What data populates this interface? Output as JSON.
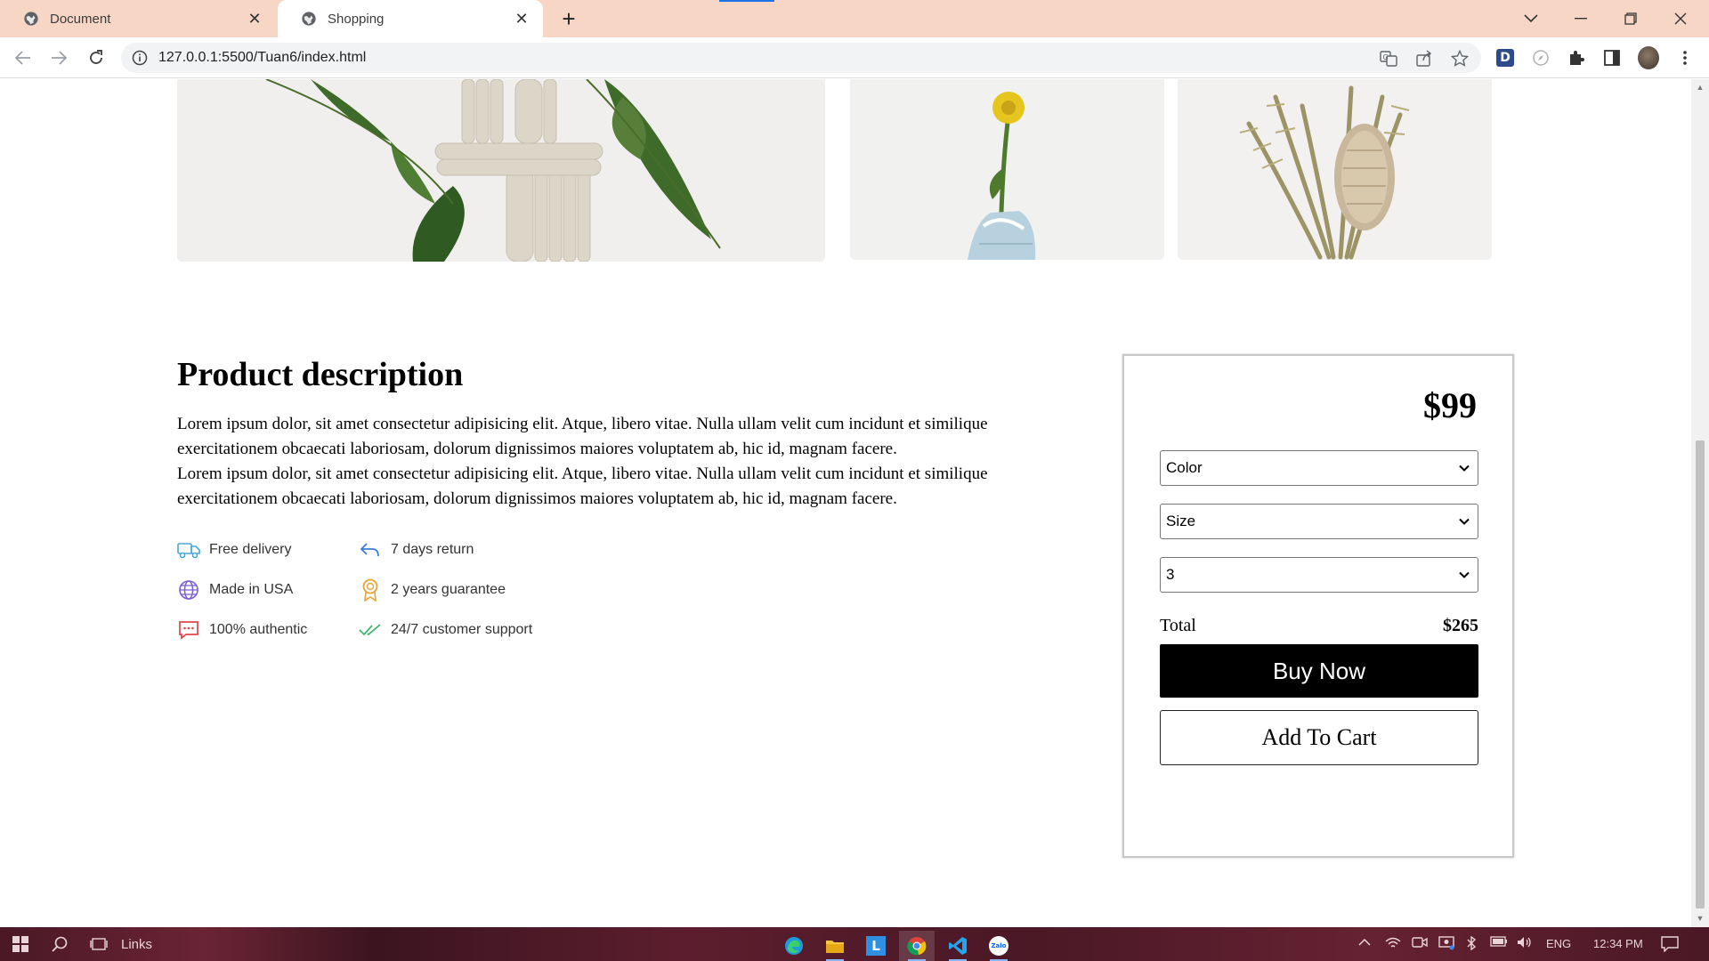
{
  "browser": {
    "tabs": [
      {
        "title": "Document",
        "active": false
      },
      {
        "title": "Shopping",
        "active": true
      }
    ],
    "url": "127.0.0.1:5500/Tuan6/index.html",
    "profile_extension_letter": "D"
  },
  "description": {
    "title": "Product description",
    "paragraphs": [
      "Lorem ipsum dolor, sit amet consectetur adipisicing elit. Atque, libero vitae. Nulla ullam velit cum incidunt et similique exercitationem obcaecati laboriosam, dolorum dignissimos maiores voluptatem ab, hic id, magnam facere.",
      "Lorem ipsum dolor, sit amet consectetur adipisicing elit. Atque, libero vitae. Nulla ullam velit cum incidunt et similique exercitationem obcaecati laboriosam, dolorum dignissimos maiores voluptatem ab, hic id, magnam facere."
    ]
  },
  "features": [
    {
      "label": "Free delivery",
      "icon": "truck-icon",
      "color": "#4aa8d8"
    },
    {
      "label": "7 days return",
      "icon": "return-arrow-icon",
      "color": "#3b7dd8"
    },
    {
      "label": "Made in USA",
      "icon": "globe-icon",
      "color": "#7b5cd6"
    },
    {
      "label": "2 years guarantee",
      "icon": "medal-icon",
      "color": "#e8a33a"
    },
    {
      "label": "100% authentic",
      "icon": "chat-bubble-icon",
      "color": "#e0474c"
    },
    {
      "label": "24/7 customer support",
      "icon": "double-check-icon",
      "color": "#3fb86b"
    }
  ],
  "purchase": {
    "price": "$99",
    "color_select": "Color",
    "size_select": "Size",
    "quantity_select": "3",
    "total_label": "Total",
    "total_value": "$265",
    "buy_label": "Buy Now",
    "cart_label": "Add To Cart"
  },
  "taskbar": {
    "search_label": "Links",
    "language": "ENG",
    "time": "12:34 PM"
  },
  "colors": {
    "tabbar": "#f7d6c6",
    "buy_button": "#000000"
  }
}
